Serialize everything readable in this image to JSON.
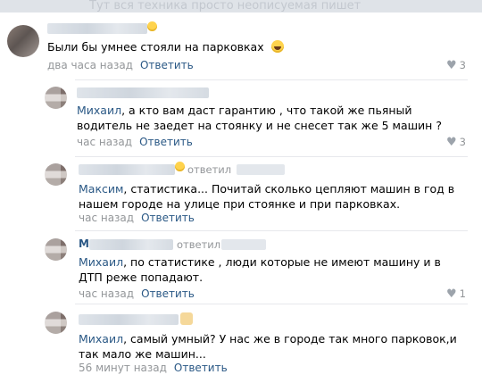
{
  "top_ghost_text": "Тут вся техника просто неописуемая пишет",
  "comments": [
    {
      "text": "Были бы умнее стояли на парковках",
      "time": "два часа назад",
      "reply_label": "Ответить",
      "likes": "3",
      "emoji": "laugh-emoji"
    },
    {
      "mention": "Михаил",
      "text": ", а кто вам даст гарантию , что такой же пьяный водитель не заедет на стоянку и не снесет так же 5 машин ?",
      "time": "час назад",
      "reply_label": "Ответить",
      "likes": "3"
    },
    {
      "replied_to_label": "ответил",
      "mention": "Максим",
      "text": ", статистика... Почитай сколько цепляют машин в год в нашем городе на улице при стоянке и при парковках.",
      "time": "час назад",
      "reply_label": "Ответить",
      "likes": ""
    },
    {
      "author_fragment": "М",
      "replied_to_label": "ответил",
      "mention": "Михаил",
      "text": ", по статистике , люди которые не имеют машину и в ДТП реже попадают.",
      "time": "час назад",
      "reply_label": "Ответить",
      "likes": "1"
    },
    {
      "mention": "Михаил",
      "text": ", самый умный? У нас же в городе так много парковок,и так мало же машин...",
      "time": "56 минут назад",
      "reply_label": "Ответить",
      "likes": ""
    }
  ]
}
